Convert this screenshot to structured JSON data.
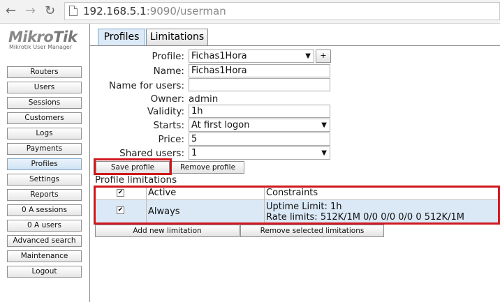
{
  "browser": {
    "url_host": "192.168.5.1",
    "url_path": ":9090/userman"
  },
  "logo": {
    "brand_a": "Mikro",
    "brand_b": "Tik",
    "subtitle": "Mikrotik User Manager"
  },
  "sidebar": {
    "items": [
      {
        "label": "Routers"
      },
      {
        "label": "Users"
      },
      {
        "label": "Sessions"
      },
      {
        "label": "Customers"
      },
      {
        "label": "Logs"
      },
      {
        "label": "Payments"
      },
      {
        "label": "Profiles",
        "active": true
      },
      {
        "label": "Settings"
      },
      {
        "label": "Reports"
      },
      {
        "label": "0 A sessions"
      },
      {
        "label": "0 A users"
      },
      {
        "label": "Advanced search"
      },
      {
        "label": "Maintenance"
      },
      {
        "label": "Logout"
      }
    ]
  },
  "tabs": [
    {
      "label": "Profiles",
      "active": true
    },
    {
      "label": "Limitations"
    }
  ],
  "form": {
    "profile_label": "Profile:",
    "profile_value": "Fichas1Hora",
    "plus_label": "+",
    "name_label": "Name:",
    "name_value": "Fichas1Hora",
    "name_for_users_label": "Name for users:",
    "name_for_users_value": "",
    "owner_label": "Owner:",
    "owner_value": "admin",
    "validity_label": "Validity:",
    "validity_value": "1h",
    "starts_label": "Starts:",
    "starts_value": "At first logon",
    "price_label": "Price:",
    "price_value": "5",
    "shared_users_label": "Shared users:",
    "shared_users_value": "1"
  },
  "buttons": {
    "save_profile": "Save profile",
    "remove_profile": "Remove profile",
    "add_limitation": "Add new limitation",
    "remove_limitations": "Remove selected limitations"
  },
  "limitations": {
    "section_title": "Profile limitations",
    "columns": [
      "Active",
      "Constraints"
    ],
    "rows": [
      {
        "active": "Always",
        "constraint_1": "Uptime Limit: 1h",
        "constraint_2": "Rate limits: 512K/1M 0/0 0/0 0/0 0 512K/1M"
      }
    ]
  },
  "colors": {
    "highlight_box": "#d0181e",
    "selected_row": "#dbe9f7"
  }
}
